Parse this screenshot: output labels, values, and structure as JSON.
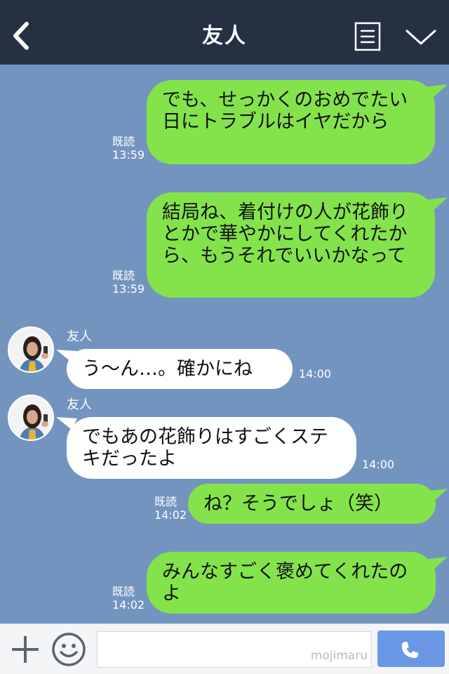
{
  "header": {
    "title": "友人"
  },
  "messages": [
    {
      "direction": "out",
      "text": "でも、せっかくのおめでたい日にトラブルはイヤだから",
      "read_label": "既読",
      "time": "13:59"
    },
    {
      "direction": "out",
      "text": "結局ね、着付けの人が花飾りとかで華やかにしてくれたから、もうそれでいいかなって",
      "read_label": "既読",
      "time": "13:59"
    },
    {
      "direction": "in",
      "sender": "友人",
      "text": "う〜ん…。確かにね",
      "time": "14:00"
    },
    {
      "direction": "in",
      "sender": "友人",
      "text": "でもあの花飾りはすごくステキだったよ",
      "time": "14:00"
    },
    {
      "direction": "out",
      "text": "ね？そうでしょ（笑）",
      "read_label": "既読",
      "time": "14:02"
    },
    {
      "direction": "out",
      "text": "みんなすごく褒めてくれたのよ",
      "read_label": "既読",
      "time": "14:02"
    }
  ],
  "footer": {
    "input_value": "",
    "watermark": "mojimaru"
  },
  "colors": {
    "header_bg": "#253042",
    "chat_bg": "#7494c0",
    "outgoing_bubble": "#84e34b",
    "incoming_bubble": "#ffffff",
    "call_button": "#6a98e6"
  },
  "icons": {
    "back": "chevron-left-icon",
    "menu": "notes-list-icon",
    "collapse": "chevron-down-icon",
    "add": "plus-icon",
    "emoji": "smiley-icon",
    "call": "phone-icon"
  }
}
